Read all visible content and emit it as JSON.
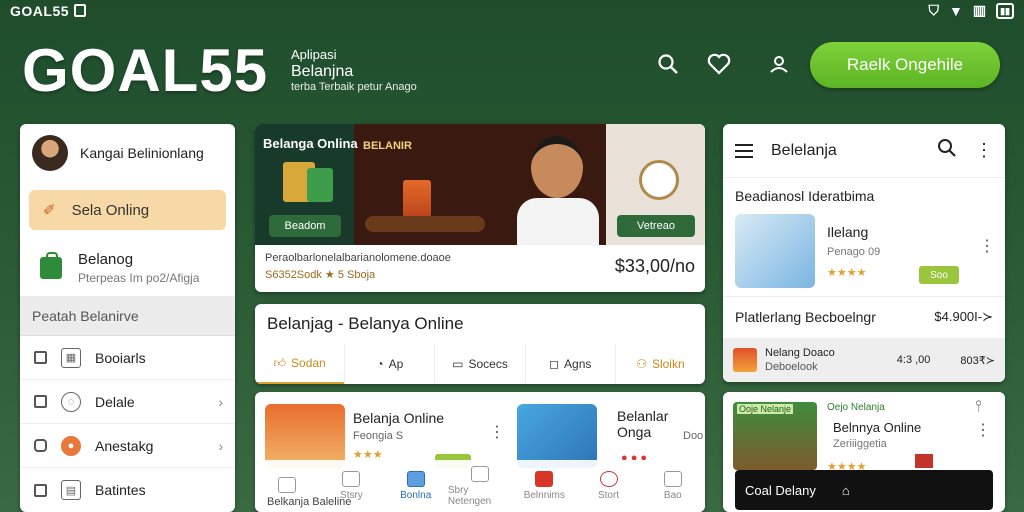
{
  "status_bar": {
    "brand": "GOAL55"
  },
  "header": {
    "logo": "GOAL55",
    "tagline_line1": "Aplipasi",
    "tagline_line2": "Belanjna",
    "tagline_line3": "terba Terbaik petur Anago",
    "cta_label": "Raelk Ongehile",
    "accent": "#63b92a"
  },
  "sidebar": {
    "user_name": "Kangai Belinionlang",
    "active_item": "Sela Onling",
    "belanja_title": "Belanog",
    "belanja_sub": "Pterpeas Im po2/Afigja",
    "section_header": "Peatah Belanirve",
    "rows": [
      {
        "label": "Booiarls",
        "icon": "grid-icon"
      },
      {
        "label": "Delale",
        "icon": "chat-icon"
      },
      {
        "label": "Anestakg",
        "icon": "person-icon"
      },
      {
        "label": "Batintes",
        "icon": "table-icon"
      }
    ]
  },
  "banner": {
    "tag1": "Belanga Onlina",
    "tag2": "BELANIR",
    "btn_left": "Beadom",
    "btn_right": "Vetreao",
    "line1": "Peraolbarlonelalbarianolomene.doaoe",
    "line2": "S6352Sodk ★ 5 Sboja",
    "price": "$33,00/no"
  },
  "tabs_card": {
    "title": "Belanjag - Belanya Online",
    "tabs": [
      {
        "label": "Sodan",
        "icon": "thumb-icon"
      },
      {
        "label": "Ap",
        "icon": "circle-icon"
      },
      {
        "label": "Socecs",
        "icon": "chat-icon"
      },
      {
        "label": "Agns",
        "icon": "message-icon"
      },
      {
        "label": "Sloikn",
        "icon": "people-icon"
      }
    ]
  },
  "grid": {
    "item1_name": "Belanja  Online",
    "item1_sub": "Feongia S",
    "item1_rating": "★★★",
    "item2_name": "Belanlar Onga",
    "item2_sub": "Doo",
    "footer": "Belkanja Baleline",
    "nav": [
      {
        "label": "",
        "icon": "home-icon"
      },
      {
        "label": "Stsry",
        "icon": "box-icon"
      },
      {
        "label": "Bonlna",
        "icon": "bag-icon"
      },
      {
        "label": "Sbry Netengen",
        "icon": "cart-icon"
      },
      {
        "label": "Belnnims",
        "icon": "store-icon"
      },
      {
        "label": "Stort",
        "icon": "settings-icon"
      },
      {
        "label": "Bao",
        "icon": "profile-icon"
      }
    ]
  },
  "right_panel": {
    "app_title": "Belelanja",
    "section": "Beadianosl Ideratbima",
    "product_title": "Ilelang",
    "product_sub": "Penago 09",
    "product_rating": "★★★★",
    "product_pill": "Soo",
    "row_a_label": "Platlerlang Becboelngr",
    "row_a_price": "$4.900I-≻",
    "row_b_title": "Nelang Doaco",
    "row_b_sub": "Deboelook",
    "row_b_mid": "4:3 ,00",
    "row_b_right": "803₹≻"
  },
  "right_bottom": {
    "img_label": "Ooje Nelanje",
    "line1": "Oejo Nelanja",
    "line2": "Belnnya Online",
    "line3": "Zeriiiggetia",
    "rating": "★★★★",
    "bar_label": "Coal  Delany"
  }
}
